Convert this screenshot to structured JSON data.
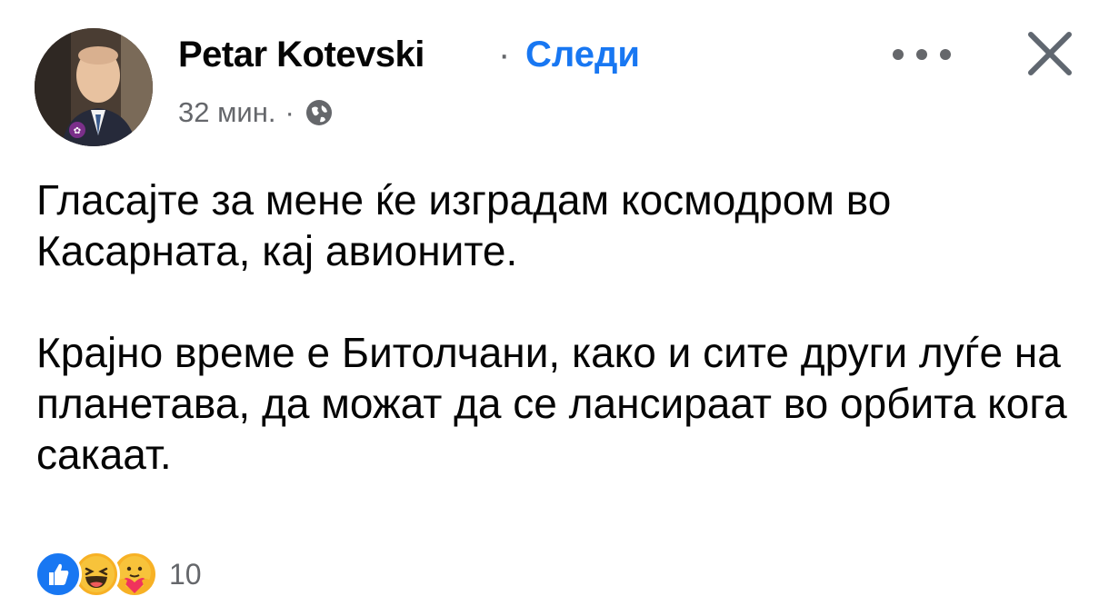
{
  "post": {
    "author": "Petar Kotevski",
    "separator": "·",
    "follow_label": "Следи",
    "time": "32 мин.",
    "time_separator": "·",
    "privacy_icon": "globe-icon",
    "more_icon": "more-options-icon",
    "close_icon": "close-icon",
    "paragraphs": [
      "Гласајте за мене ќе изградам космодром во Касарната, кај авионите.",
      "Крајно време е Битолчани, како и сите други луѓе на планетава, да можат да се лансираат во орбита кога сакаат."
    ],
    "reactions": {
      "icons": [
        "like-icon",
        "haha-icon",
        "care-icon"
      ],
      "count": "10"
    }
  },
  "colors": {
    "accent": "#1877f2",
    "secondary_text": "#65676b",
    "primary_text": "#050505"
  }
}
